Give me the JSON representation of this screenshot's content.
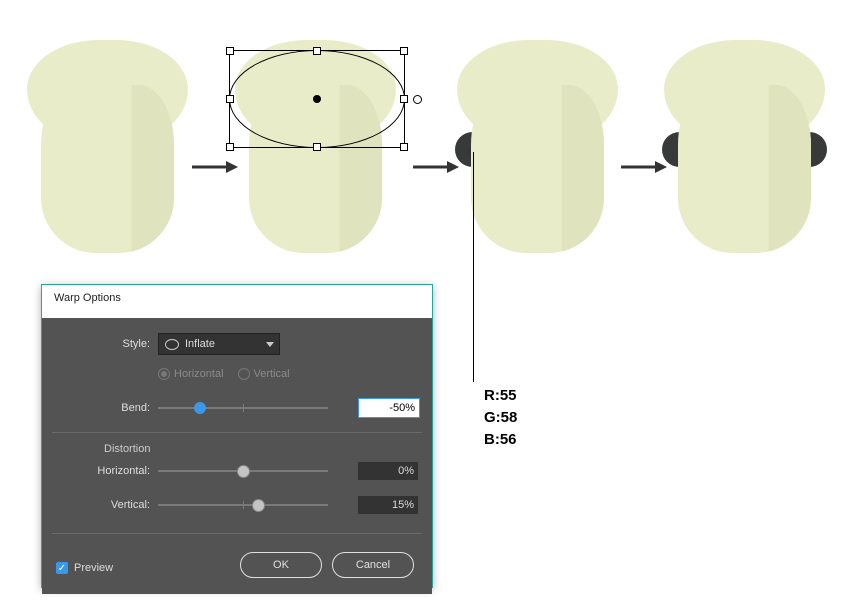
{
  "dialog": {
    "title": "Warp Options",
    "labels": {
      "style": "Style:",
      "bend": "Bend:",
      "distortion": "Distortion",
      "horizontal": "Horizontal:",
      "vertical": "Vertical:"
    },
    "style_value": "Inflate",
    "orient": {
      "horizontal": "Horizontal",
      "vertical": "Vertical",
      "selected": "horizontal"
    },
    "bend": {
      "value": -50,
      "display": "-50%"
    },
    "distortion_h": {
      "value": 0,
      "display": "0%"
    },
    "distortion_v": {
      "value": 15,
      "display": "15%"
    },
    "preview_enabled": true,
    "preview_label": "Preview",
    "ok": "OK",
    "cancel": "Cancel"
  },
  "callout": {
    "r": "R:55",
    "g": "G:58",
    "b": "B:56",
    "color": "#373a38"
  },
  "steps": [
    {
      "name": "base-shape"
    },
    {
      "name": "selection-ellipse"
    },
    {
      "name": "one-ear"
    },
    {
      "name": "two-ears"
    }
  ]
}
